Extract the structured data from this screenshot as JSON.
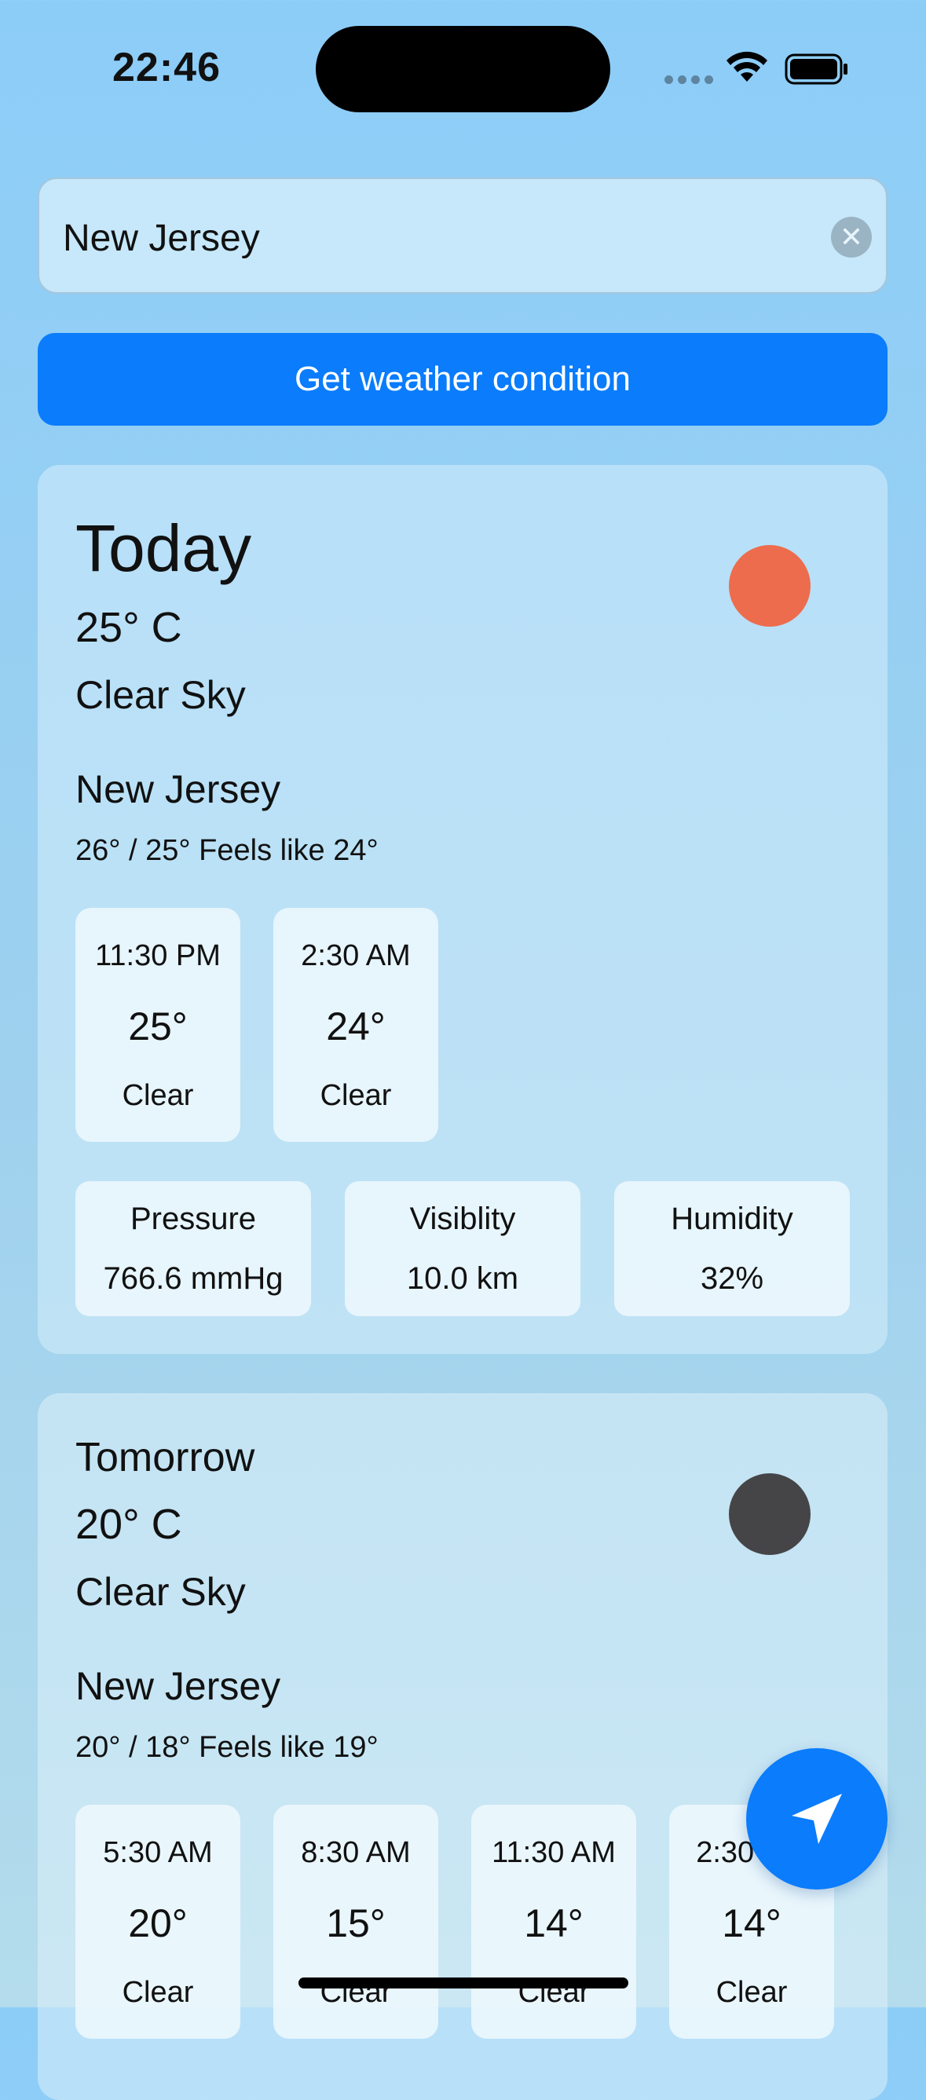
{
  "status_bar": {
    "time": "22:46"
  },
  "search": {
    "value": "New Jersey",
    "clear_glyph": "✕"
  },
  "button": {
    "label": "Get weather condition"
  },
  "today": {
    "title": "Today",
    "temp": "25° C",
    "condition": "Clear Sky",
    "city": "New Jersey",
    "range": "26° / 25° Feels like 24°",
    "icon_color": "#ed6c4d",
    "hours": [
      {
        "time": "11:30 PM",
        "temp": "25°",
        "cond": "Clear"
      },
      {
        "time": "2:30 AM",
        "temp": "24°",
        "cond": "Clear"
      }
    ],
    "stats": [
      {
        "label": "Pressure",
        "value": "766.6 mmHg"
      },
      {
        "label": "Visiblity",
        "value": "10.0 km"
      },
      {
        "label": "Humidity",
        "value": "32%"
      }
    ]
  },
  "tomorrow": {
    "title": "Tomorrow",
    "temp": "20° C",
    "condition": "Clear Sky",
    "city": "New Jersey",
    "range": "20° / 18° Feels like 19°",
    "icon_color": "#454547",
    "hours": [
      {
        "time": "5:30 AM",
        "temp": "20°",
        "cond": "Clear"
      },
      {
        "time": "8:30 AM",
        "temp": "15°",
        "cond": "Clear"
      },
      {
        "time": "11:30 AM",
        "temp": "14°",
        "cond": "Clear"
      },
      {
        "time": "2:30 PM",
        "temp": "14°",
        "cond": "Clear"
      }
    ]
  },
  "fab": {
    "icon": "location-arrow-icon",
    "color": "#0a7cfc"
  }
}
